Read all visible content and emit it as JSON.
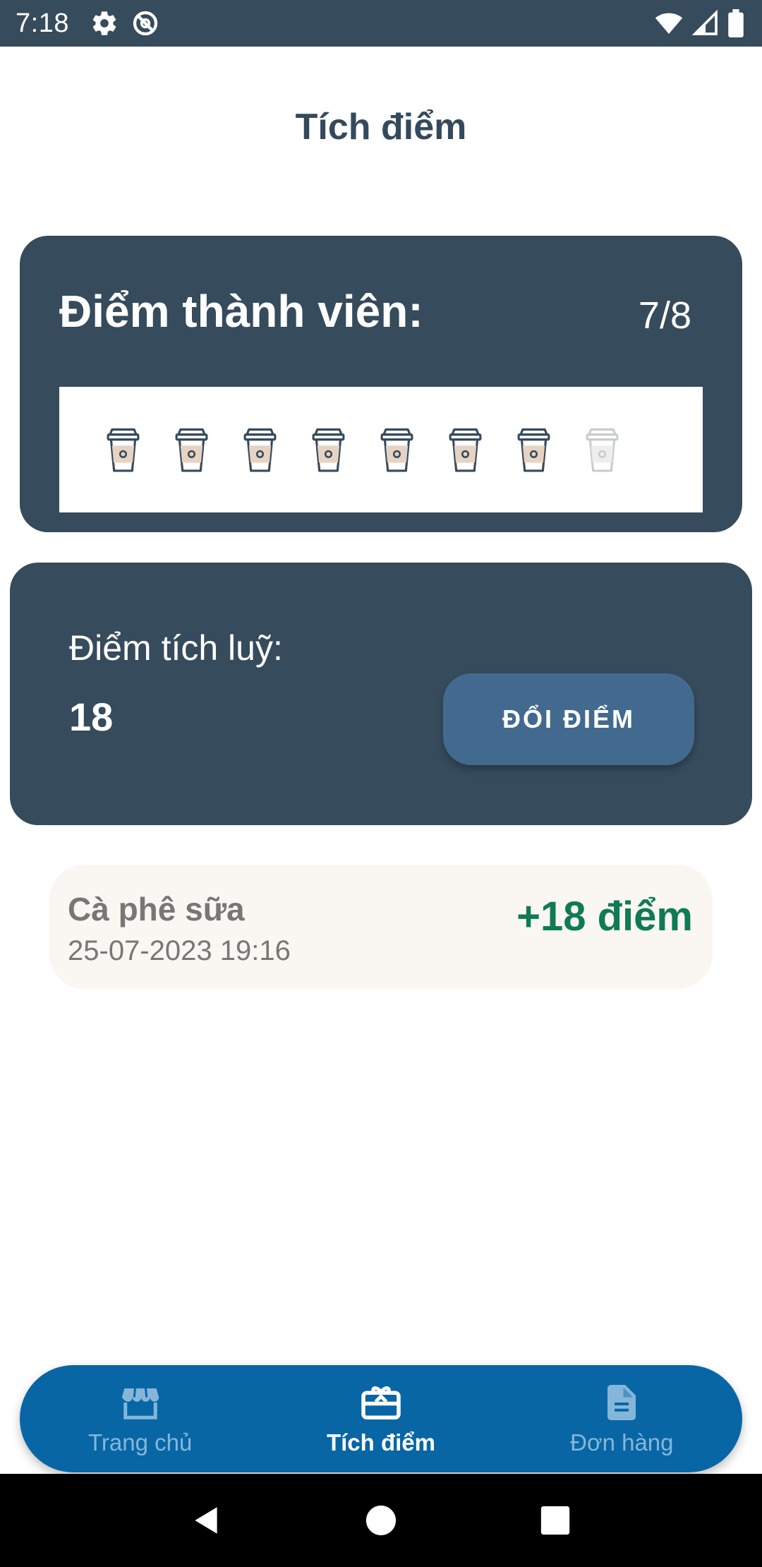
{
  "status_bar": {
    "time": "7:18",
    "icons": [
      "gear-icon",
      "no-sync-icon",
      "wifi-icon",
      "signal-icon",
      "battery-icon"
    ]
  },
  "page": {
    "title": "Tích điểm"
  },
  "member_card": {
    "label": "Điểm thành viên:",
    "value": "7/8",
    "cups_filled": 7,
    "cups_total": 8
  },
  "accumulated": {
    "label": "Điểm tích luỹ:",
    "value": "18",
    "redeem_label": "ĐỔI ĐIỂM"
  },
  "history": [
    {
      "name": "Cà phê sữa",
      "date": "25-07-2023 19:16",
      "points": "+18 điểm"
    }
  ],
  "bottom_nav": {
    "items": [
      {
        "label": "Trang chủ",
        "icon": "store-icon",
        "active": false
      },
      {
        "label": "Tích điểm",
        "icon": "gift-card-icon",
        "active": true
      },
      {
        "label": "Đơn hàng",
        "icon": "document-icon",
        "active": false
      }
    ]
  },
  "colors": {
    "dark_slate": "#364b5c",
    "title": "#34495c",
    "button": "#426a8e",
    "nav": "#0866a5",
    "points_green": "#0f7b55",
    "history_bg": "#faf6f1"
  }
}
